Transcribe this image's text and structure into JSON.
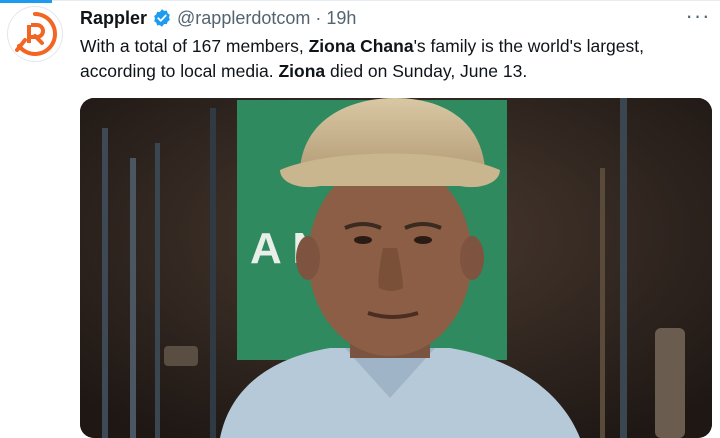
{
  "tweet": {
    "author_name": "Rappler",
    "handle": "@rapplerdotcom",
    "separator": "·",
    "time": "19h",
    "more_label": "···",
    "text": {
      "part1": "With a total of 167 members, ",
      "bold1": "Ziona Chana",
      "part2": "'s family is the world's largest, according to local media. ",
      "bold2": "Ziona",
      "part3": " died on Sunday, June 13."
    },
    "avatar_icon": "rappler-logo-icon",
    "verified_icon": "verified-badge-icon",
    "media": {
      "sign_text": "A     N"
    }
  },
  "colors": {
    "accent": "#1d9bf0",
    "rappler_orange": "#f26522",
    "sign_green": "#2f8a5f"
  }
}
